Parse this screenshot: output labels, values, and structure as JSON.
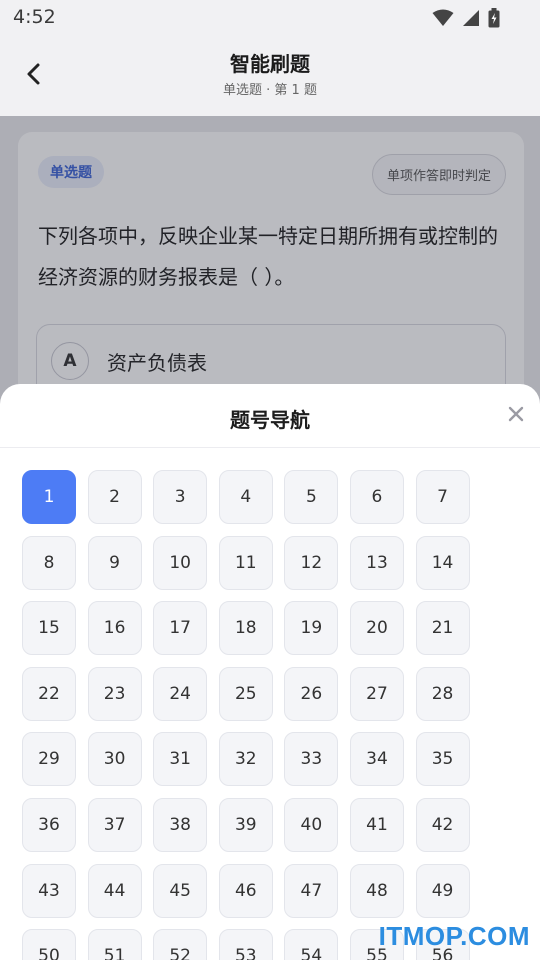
{
  "status": {
    "time": "4:52"
  },
  "header": {
    "title": "智能刷题",
    "subtitle": "单选题 · 第 1 题"
  },
  "question": {
    "type_badge": "单选题",
    "mode": "单项作答即时判定",
    "text": "下列各项中，反映企业某一特定日期所拥有或控制的经济资源的财务报表是（   ）。",
    "options": [
      {
        "letter": "A",
        "text": "资产负债表"
      }
    ]
  },
  "nav_sheet": {
    "title": "题号导航",
    "current": 1,
    "numbers": [
      "1",
      "2",
      "3",
      "4",
      "5",
      "6",
      "7",
      "8",
      "9",
      "10",
      "11",
      "12",
      "13",
      "14",
      "15",
      "16",
      "17",
      "18",
      "19",
      "20",
      "21",
      "22",
      "23",
      "24",
      "25",
      "26",
      "27",
      "28",
      "29",
      "30",
      "31",
      "32",
      "33",
      "34",
      "35",
      "36",
      "37",
      "38",
      "39",
      "40",
      "41",
      "42",
      "43",
      "44",
      "45",
      "46",
      "47",
      "48",
      "49",
      "50",
      "51",
      "52",
      "53",
      "54",
      "55",
      "56"
    ]
  },
  "watermark": "ITMOP.COM",
  "colors": {
    "accent": "#4d7cf5",
    "badge_text": "#3c63d6",
    "watermark": "#2c8de0"
  }
}
